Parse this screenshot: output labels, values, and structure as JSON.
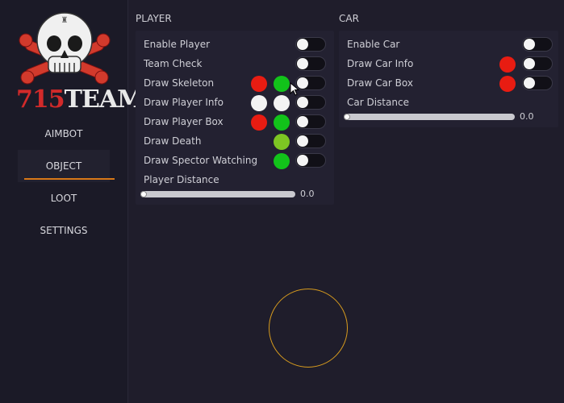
{
  "logo": {
    "text_red": "715",
    "text_white": "TEAM"
  },
  "nav": [
    {
      "label": "AIMBOT",
      "active": false
    },
    {
      "label": "OBJECT",
      "active": true
    },
    {
      "label": "LOOT",
      "active": false
    },
    {
      "label": "SETTINGS",
      "active": false
    }
  ],
  "player": {
    "title": "PLAYER",
    "rows": [
      {
        "label": "Enable Player"
      },
      {
        "label": "Team Check"
      },
      {
        "label": "Draw Skeleton"
      },
      {
        "label": "Draw Player Info"
      },
      {
        "label": "Draw Player Box"
      },
      {
        "label": "Draw Death"
      },
      {
        "label": "Draw Spector Watching"
      }
    ],
    "distance_label": "Player Distance",
    "distance_value": "0.0"
  },
  "car": {
    "title": "CAR",
    "rows": [
      {
        "label": "Enable Car"
      },
      {
        "label": "Draw Car Info"
      },
      {
        "label": "Draw Car Box"
      }
    ],
    "distance_label": "Car Distance",
    "distance_value": "0.0"
  },
  "colors": {
    "red": "#e81c12",
    "green": "#12c31a",
    "lime": "#7dc623",
    "white": "#f3f3f3",
    "accent": "#d87818",
    "fov_circle": "#d79b1e"
  }
}
